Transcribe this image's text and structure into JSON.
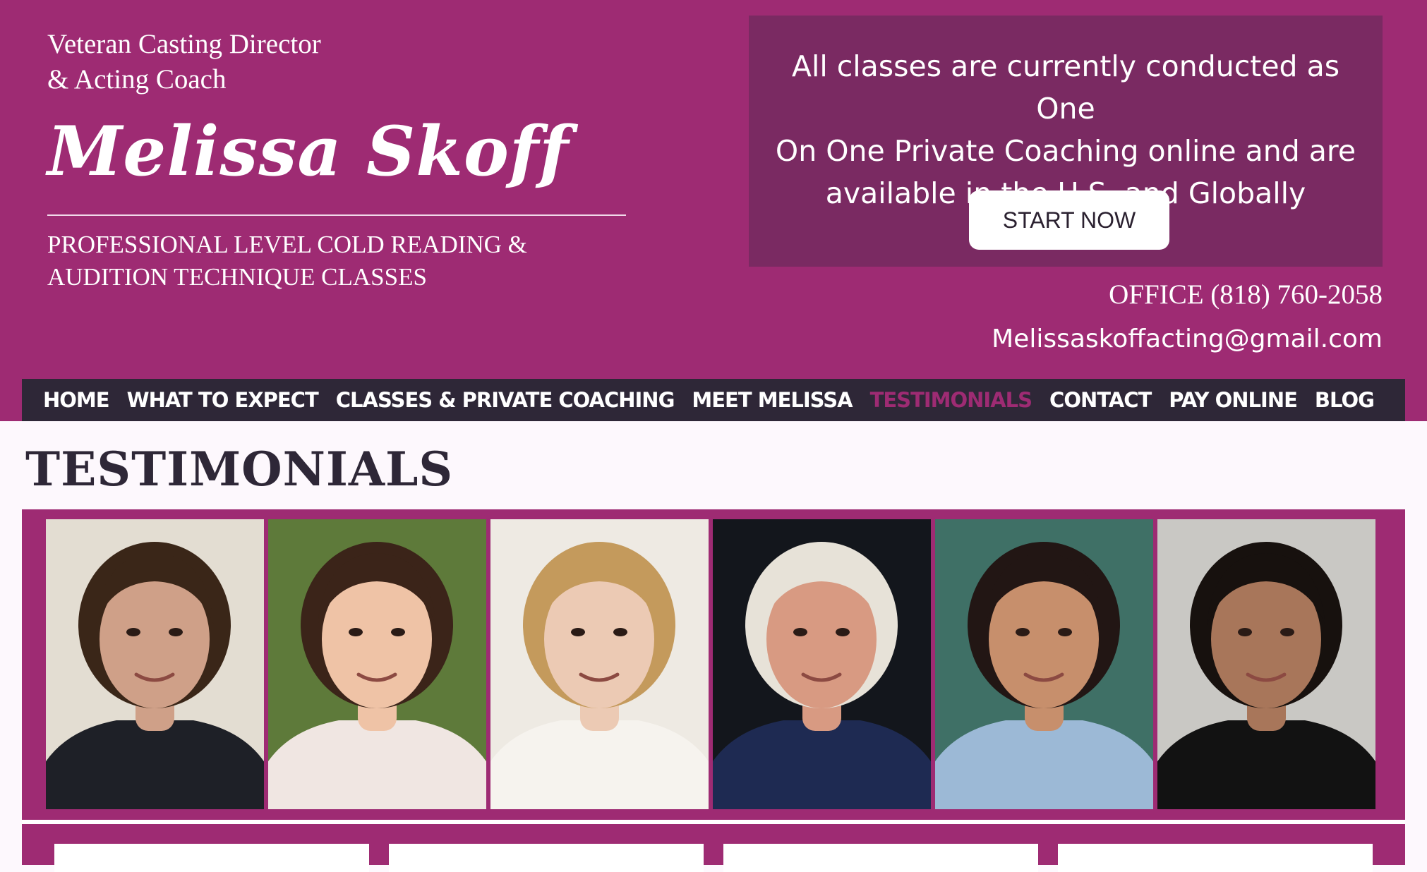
{
  "header": {
    "tagline_line1": "Veteran Casting Director",
    "tagline_line2": "& Acting Coach",
    "name": "Melissa Skoff",
    "subtitle_line1": "PROFESSIONAL LEVEL COLD READING &",
    "subtitle_line2": "AUDITION TECHNIQUE CLASSES",
    "office": "OFFICE (818) 760-2058",
    "email": "Melissaskoffacting@gmail.com"
  },
  "promo": {
    "line1": "All classes are currently conducted as One",
    "line2": "On One Private Coaching online and are",
    "line3": "available in the U.S. and Globally",
    "button_label": "START NOW"
  },
  "nav": {
    "items": [
      {
        "label": "HOME",
        "active": false
      },
      {
        "label": "WHAT TO EXPECT",
        "active": false
      },
      {
        "label": "CLASSES & PRIVATE COACHING",
        "active": false
      },
      {
        "label": "MEET MELISSA",
        "active": false
      },
      {
        "label": "TESTIMONIALS",
        "active": true
      },
      {
        "label": "CONTACT",
        "active": false
      },
      {
        "label": "PAY ONLINE",
        "active": false
      },
      {
        "label": "BLOG",
        "active": false
      }
    ]
  },
  "main": {
    "page_title": "TESTIMONIALS"
  },
  "photos": [
    {
      "icon": "headshot-man-beard",
      "bg": "#e3ddd2",
      "skin": "#cfa088",
      "hair": "#3a2618",
      "top": "#1e2027"
    },
    {
      "icon": "headshot-woman-glasses",
      "bg": "#5e7a3a",
      "skin": "#efc3a6",
      "hair": "#3b2419",
      "top": "#f0e6e2"
    },
    {
      "icon": "headshot-woman-blonde",
      "bg": "#eeeae3",
      "skin": "#eccab4",
      "hair": "#c49a5c",
      "top": "#f6f3ee"
    },
    {
      "icon": "headshot-older-man",
      "bg": "#13161c",
      "skin": "#d89a82",
      "hair": "#e7e2d8",
      "top": "#1e2a52"
    },
    {
      "icon": "headshot-girl",
      "bg": "#3f7066",
      "skin": "#c78f6c",
      "hair": "#221614",
      "top": "#9cb9d6"
    },
    {
      "icon": "headshot-man-suit",
      "bg": "#c9c8c4",
      "skin": "#a8765a",
      "hair": "#17110e",
      "top": "#121212"
    }
  ],
  "colors": {
    "brand": "#9e2b73",
    "promo_bg": "#7a2a62",
    "nav_bg": "#2e2737",
    "nav_active": "#9e2b73",
    "page_bg": "#fdf8fd"
  }
}
